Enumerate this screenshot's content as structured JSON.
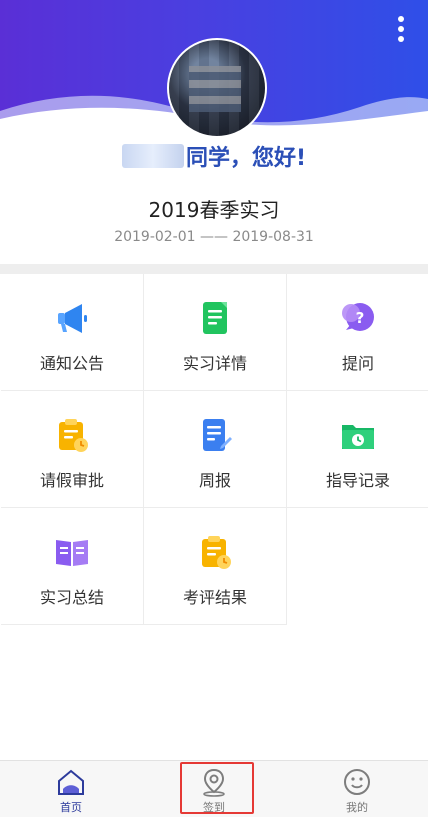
{
  "greeting": {
    "text": "同学，您好!"
  },
  "program": {
    "name": "2019春季实习",
    "dates": "2019-02-01 —— 2019-08-31"
  },
  "menu": [
    {
      "label": "通知公告",
      "icon": "megaphone-icon",
      "color": "#3a8ef0"
    },
    {
      "label": "实习详情",
      "icon": "document-icon",
      "color": "#1fc15e"
    },
    {
      "label": "提问",
      "icon": "question-chat-icon",
      "color": "#8a5cf0"
    },
    {
      "label": "请假审批",
      "icon": "clipboard-clock-icon",
      "color": "#f6b400"
    },
    {
      "label": "周报",
      "icon": "report-edit-icon",
      "color": "#3a7ff0"
    },
    {
      "label": "指导记录",
      "icon": "folder-clock-icon",
      "color": "#18b866"
    },
    {
      "label": "实习总结",
      "icon": "book-icon",
      "color": "#8a5cf0"
    },
    {
      "label": "考评结果",
      "icon": "clipboard-clock-icon",
      "color": "#f6b400"
    }
  ],
  "tabs": [
    {
      "label": "首页",
      "icon": "home-icon",
      "active": true
    },
    {
      "label": "签到",
      "icon": "location-pin-icon",
      "active": false
    },
    {
      "label": "我的",
      "icon": "smiley-icon",
      "active": false
    }
  ]
}
